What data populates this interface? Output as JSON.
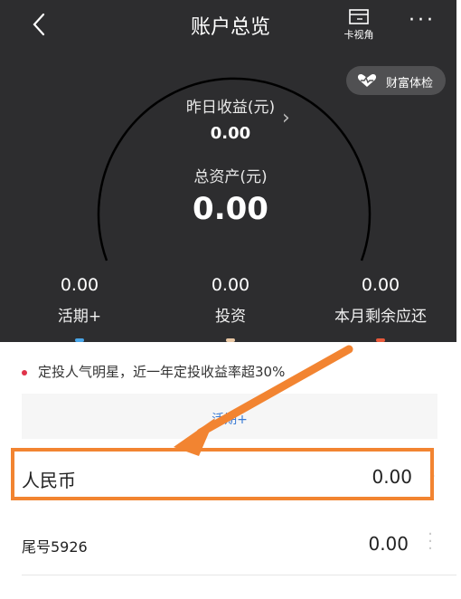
{
  "header": {
    "title": "账户总览",
    "card_view_label": "卡视角",
    "more_label": "···",
    "wealth_check_label": "财富体检"
  },
  "summary": {
    "yesterday_label": "昨日收益(元)",
    "yesterday_value": "0.00",
    "total_label": "总资产(元)",
    "total_value": "0.00"
  },
  "stats": [
    {
      "value": "0.00",
      "label": "活期+",
      "color": "#4aa6e8"
    },
    {
      "value": "0.00",
      "label": "投资",
      "color": "#e8c7a4"
    },
    {
      "value": "0.00",
      "label": "本月剩余应还",
      "color": "#e85a3b"
    }
  ],
  "notice": "定投人气明星，近一年定投收益率超30%",
  "tab_label": "活期+",
  "rows": [
    {
      "name": "人民币",
      "value": "0.00"
    }
  ],
  "card_row": {
    "name": "尾号5926",
    "value": "0.00"
  },
  "highlight_color": "#f28431"
}
